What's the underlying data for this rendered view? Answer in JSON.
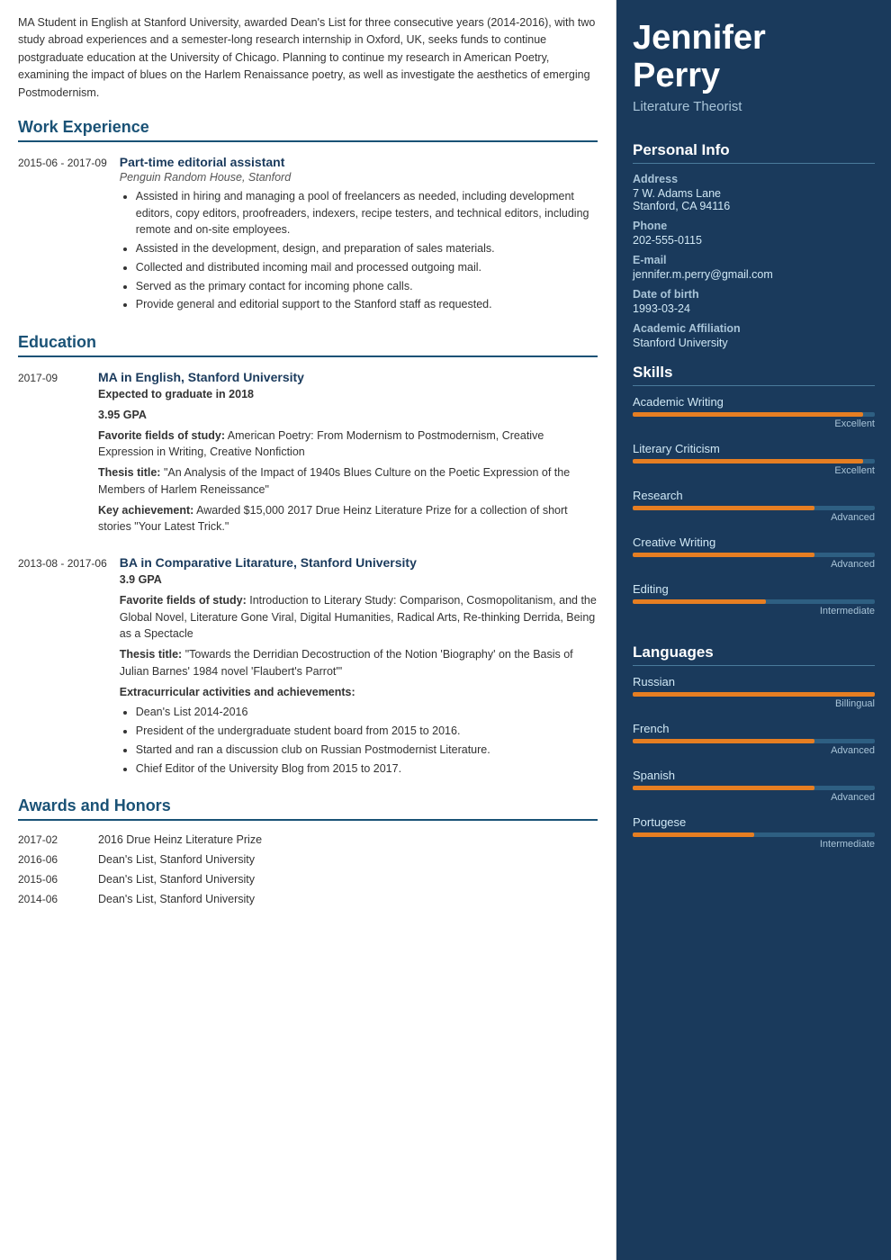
{
  "left": {
    "intro": "MA Student in English at Stanford University, awarded Dean's List for three consecutive years (2014-2016), with two study abroad experiences and a semester-long research internship in Oxford, UK, seeks funds to continue postgraduate education at the University of Chicago. Planning to continue my research in American Poetry, examining the impact of blues on the Harlem Renaissance poetry, as well as investigate the aesthetics of emerging Postmodernism.",
    "sections": {
      "work_experience_title": "Work Experience",
      "education_title": "Education",
      "awards_title": "Awards and Honors"
    },
    "work": [
      {
        "date": "2015-06 - 2017-09",
        "title": "Part-time editorial assistant",
        "subtitle": "Penguin Random House, Stanford",
        "bullets": [
          "Assisted in hiring and managing a pool of freelancers as needed, including development editors, copy editors, proofreaders, indexers, recipe testers, and technical editors, including remote and on-site employees.",
          "Assisted in the development, design, and preparation of sales materials.",
          "Collected and distributed incoming mail and processed outgoing mail.",
          "Served as the primary contact for incoming phone calls.",
          "Provide general and editorial support to the Stanford staff as requested."
        ]
      }
    ],
    "education": [
      {
        "date": "2017-09",
        "title": "MA in English, Stanford University",
        "bold_subtitle": "Expected to graduate in 2018",
        "gpa": "3.95 GPA",
        "favorite_label": "Favorite fields of study:",
        "favorite_text": " American Poetry: From Modernism to Postmodernism, Creative Expression in Writing, Creative Nonfiction",
        "thesis_label": "Thesis title:",
        "thesis_text": " \"An Analysis of the Impact of 1940s Blues Culture on the Poetic Expression of the Members of Harlem Reneissance\"",
        "key_label": "Key achievement:",
        "key_text": " Awarded $15,000 2017 Drue Heinz Literature Prize for a collection of short stories \"Your Latest Trick.\""
      },
      {
        "date": "2013-08 - 2017-06",
        "title": "BA in Comparative Litarature, Stanford University",
        "gpa": "3.9 GPA",
        "favorite_label": "Favorite fields of study:",
        "favorite_text": " Introduction to Literary Study: Comparison, Cosmopolitanism, and the Global Novel, Literature Gone Viral, Digital Humanities, Radical Arts, Re-thinking Derrida, Being as a Spectacle",
        "thesis_label": "Thesis title:",
        "thesis_text": " \"Towards the Derridian Decostruction of the Notion 'Biography' on the Basis of Julian Barnes' 1984 novel 'Flaubert's Parrot'\"",
        "extra_label": "Extracurricular activities and achievements:",
        "extra_bullets": [
          "Dean's List 2014-2016",
          "President of the undergraduate student board from 2015 to 2016.",
          "Started and ran a discussion club on Russian Postmodernist Literature.",
          "Chief Editor of the University Blog from 2015 to 2017."
        ]
      }
    ],
    "awards": [
      {
        "date": "2017-02",
        "text": "2016 Drue Heinz Literature Prize"
      },
      {
        "date": "2016-06",
        "text": "Dean's List, Stanford University"
      },
      {
        "date": "2015-06",
        "text": "Dean's List, Stanford University"
      },
      {
        "date": "2014-06",
        "text": "Dean's List, Stanford University"
      }
    ]
  },
  "right": {
    "name_line1": "Jennifer",
    "name_line2": "Perry",
    "title": "Literature Theorist",
    "personal_info_title": "Personal Info",
    "labels": {
      "address": "Address",
      "phone": "Phone",
      "email": "E-mail",
      "dob": "Date of birth",
      "affiliation": "Academic Affiliation"
    },
    "address_line1": "7 W. Adams Lane",
    "address_line2": "Stanford, CA 94116",
    "phone": "202-555-0115",
    "email": "jennifer.m.perry@gmail.com",
    "dob": "1993-03-24",
    "affiliation": "Stanford University",
    "skills_title": "Skills",
    "skills": [
      {
        "name": "Academic Writing",
        "level": "Excellent",
        "pct": 95
      },
      {
        "name": "Literary Criticism",
        "level": "Excellent",
        "pct": 95
      },
      {
        "name": "Research",
        "level": "Advanced",
        "pct": 75
      },
      {
        "name": "Creative Writing",
        "level": "Advanced",
        "pct": 75
      },
      {
        "name": "Editing",
        "level": "Intermediate",
        "pct": 55
      }
    ],
    "languages_title": "Languages",
    "languages": [
      {
        "name": "Russian",
        "level": "Billingual",
        "pct": 100
      },
      {
        "name": "French",
        "level": "Advanced",
        "pct": 75
      },
      {
        "name": "Spanish",
        "level": "Advanced",
        "pct": 75
      },
      {
        "name": "Portugese",
        "level": "Intermediate",
        "pct": 50
      }
    ]
  }
}
